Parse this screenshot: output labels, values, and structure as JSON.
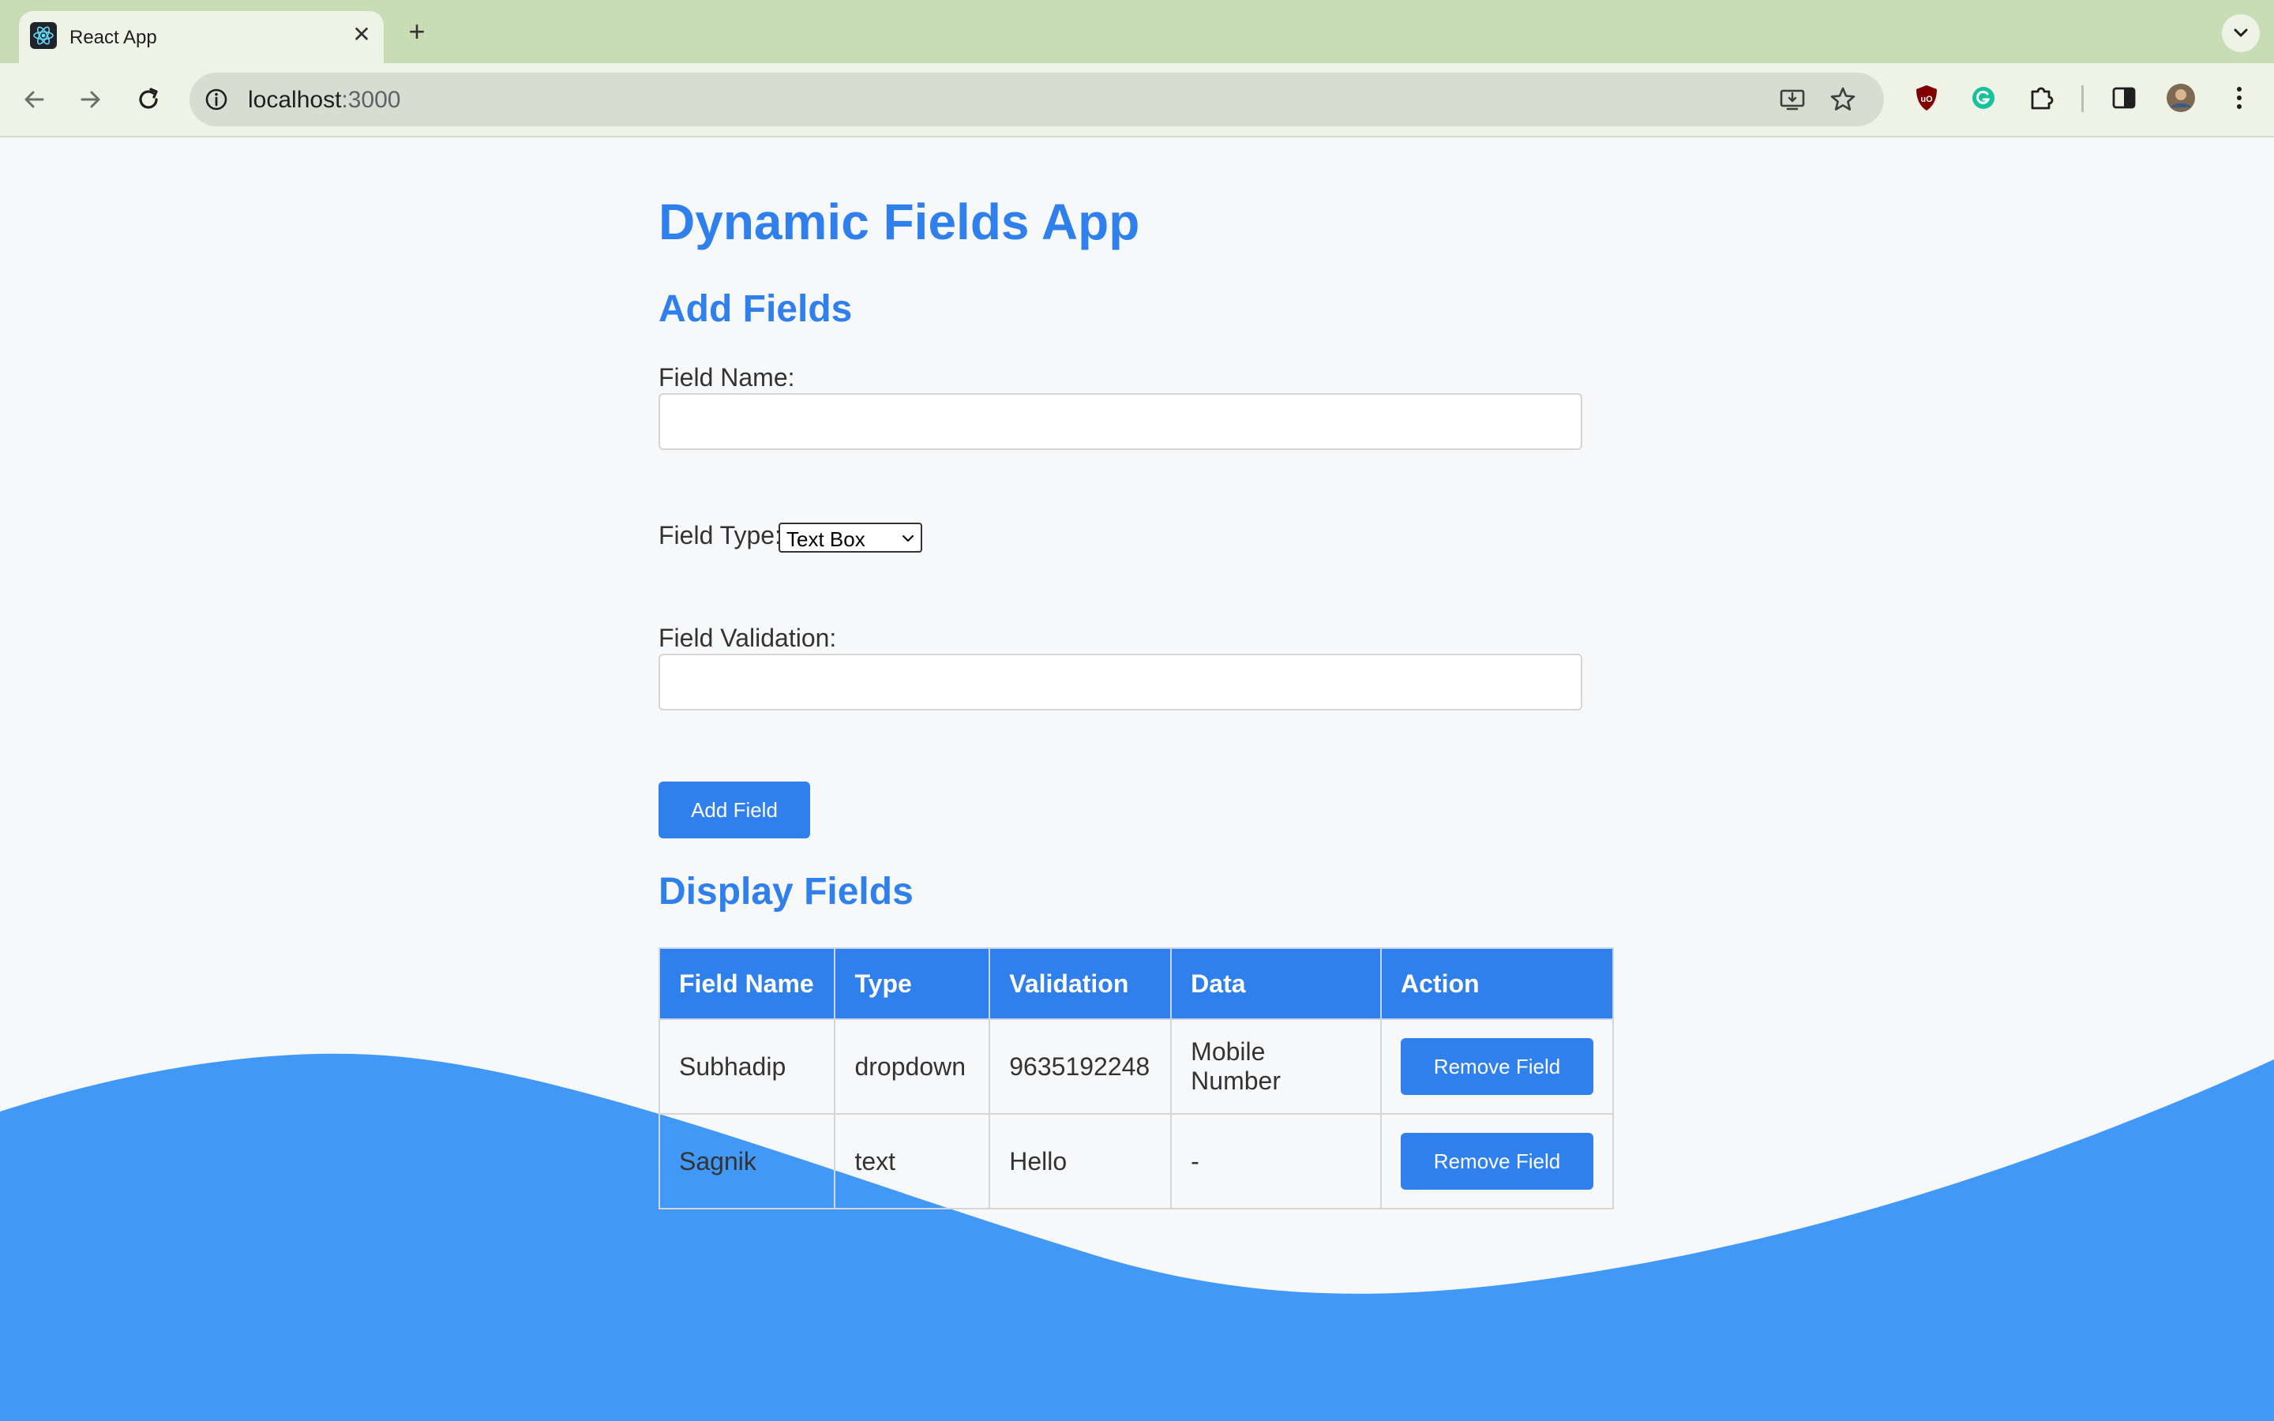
{
  "browser": {
    "tab_title": "React App",
    "url_host": "localhost",
    "url_port": ":3000"
  },
  "page": {
    "title": "Dynamic Fields App",
    "add_section_title": "Add Fields",
    "field_name_label": "Field Name:",
    "field_name_value": "",
    "field_type_label": "Field Type:",
    "field_type_selected": "Text Box",
    "field_validation_label": "Field Validation:",
    "field_validation_value": "",
    "add_button_label": "Add Field",
    "display_section_title": "Display Fields"
  },
  "table": {
    "headers": [
      "Field Name",
      "Type",
      "Validation",
      "Data",
      "Action"
    ],
    "rows": [
      {
        "field_name": "Subhadip",
        "type": "dropdown",
        "validation": "9635192248",
        "data": "Mobile Number",
        "action": "Remove Field"
      },
      {
        "field_name": "Sagnik",
        "type": "text",
        "validation": "Hello",
        "data": "-",
        "action": "Remove Field"
      }
    ]
  },
  "colors": {
    "accent": "#2f80ed",
    "wave": "#4198f7",
    "tabbar": "#c8dcb6",
    "toolbar": "#eef3e6"
  }
}
